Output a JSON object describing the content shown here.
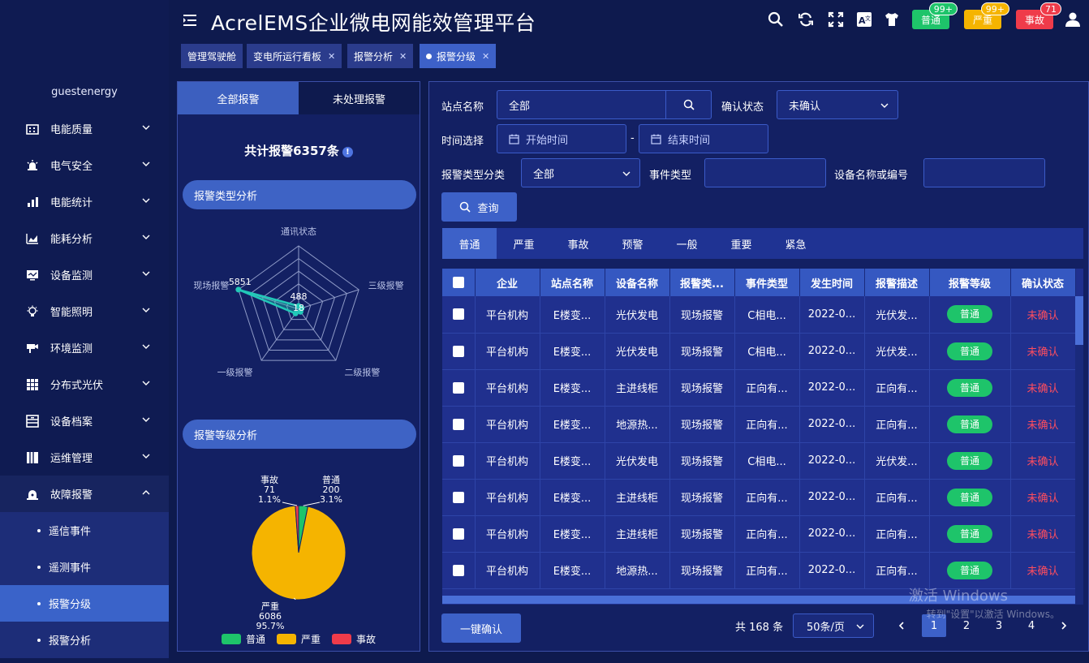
{
  "header": {
    "title": "AcrelEMS企业微电网能效管理平台",
    "badges": [
      {
        "label": "普通",
        "count": "99+",
        "color": "#1ec46a"
      },
      {
        "label": "严重",
        "count": "99+",
        "color": "#f5b400"
      },
      {
        "label": "事故",
        "count": "71",
        "color": "#ef3b4a"
      }
    ]
  },
  "tabs": [
    {
      "label": "管理驾驶舱",
      "closable": false
    },
    {
      "label": "变电所运行看板",
      "closable": true
    },
    {
      "label": "报警分析",
      "closable": true
    },
    {
      "label": "报警分级",
      "closable": true,
      "active": true
    }
  ],
  "sidebar": {
    "user": "guestenergy",
    "items": [
      {
        "label": "电能质量"
      },
      {
        "label": "电气安全"
      },
      {
        "label": "电能统计"
      },
      {
        "label": "能耗分析"
      },
      {
        "label": "设备监测"
      },
      {
        "label": "智能照明"
      },
      {
        "label": "环境监测"
      },
      {
        "label": "分布式光伏"
      },
      {
        "label": "设备档案"
      },
      {
        "label": "运维管理"
      },
      {
        "label": "故障报警"
      }
    ],
    "subitems": [
      {
        "label": "遥信事件"
      },
      {
        "label": "遥测事件"
      },
      {
        "label": "报警分级"
      },
      {
        "label": "报警分析"
      }
    ]
  },
  "left": {
    "tab_all": "全部报警",
    "tab_unhandled": "未处理报警",
    "total_label": "共计报警6357条",
    "section_type": "报警类型分析",
    "section_level": "报警等级分析",
    "legend": [
      {
        "label": "普通",
        "color": "#1ec46a"
      },
      {
        "label": "严重",
        "color": "#f5b400"
      },
      {
        "label": "事故",
        "color": "#ef3b4a"
      }
    ]
  },
  "filters": {
    "site_label": "站点名称",
    "site_value": "全部",
    "confirm_label": "确认状态",
    "confirm_value": "未确认",
    "time_label": "时间选择",
    "start_placeholder": "开始时间",
    "end_placeholder": "结束时间",
    "dash": "-",
    "type_label": "报警类型分类",
    "type_value": "全部",
    "event_label": "事件类型",
    "device_label": "设备名称或编号",
    "query_button": "查询"
  },
  "level_tabs": [
    "普通",
    "严重",
    "事故",
    "预警",
    "一般",
    "重要",
    "紧急"
  ],
  "table": {
    "headers": [
      "企业",
      "站点名称",
      "设备名称",
      "报警类...",
      "事件类型",
      "发生时间",
      "报警描述",
      "报警等级",
      "确认状态"
    ],
    "rows": [
      [
        "平台机构",
        "E楼变...",
        "光伏发电",
        "现场报警",
        "C相电...",
        "2022-0...",
        "光伏发...",
        "普通",
        "未确认"
      ],
      [
        "平台机构",
        "E楼变...",
        "光伏发电",
        "现场报警",
        "C相电...",
        "2022-0...",
        "光伏发...",
        "普通",
        "未确认"
      ],
      [
        "平台机构",
        "E楼变...",
        "主进线柜",
        "现场报警",
        "正向有...",
        "2022-0...",
        "正向有...",
        "普通",
        "未确认"
      ],
      [
        "平台机构",
        "E楼变...",
        "地源热...",
        "现场报警",
        "正向有...",
        "2022-0...",
        "正向有...",
        "普通",
        "未确认"
      ],
      [
        "平台机构",
        "E楼变...",
        "光伏发电",
        "现场报警",
        "C相电...",
        "2022-0...",
        "光伏发...",
        "普通",
        "未确认"
      ],
      [
        "平台机构",
        "E楼变...",
        "主进线柜",
        "现场报警",
        "正向有...",
        "2022-0...",
        "正向有...",
        "普通",
        "未确认"
      ],
      [
        "平台机构",
        "E楼变...",
        "主进线柜",
        "现场报警",
        "正向有...",
        "2022-0...",
        "正向有...",
        "普通",
        "未确认"
      ],
      [
        "平台机构",
        "E楼变...",
        "地源热...",
        "现场报警",
        "正向有...",
        "2022-0...",
        "正向有...",
        "普通",
        "未确认"
      ]
    ]
  },
  "footer": {
    "confirm_all": "一键确认",
    "total": "共 168 条",
    "page_size": "50条/页",
    "pages": [
      "1",
      "2",
      "3",
      "4"
    ],
    "current_page": "1"
  },
  "watermark": {
    "line1": "激活 Windows",
    "line2": "转到\"设置\"以激活 Windows。"
  },
  "chart_data": [
    {
      "type": "radar",
      "indicators": [
        "通讯状态",
        "三级报警",
        "二级报警",
        "一级报警",
        "现场报警"
      ],
      "values": [
        18,
        0,
        0,
        488,
        5851
      ],
      "labels_shown": [
        "488",
        "18",
        "5851"
      ]
    },
    {
      "type": "pie",
      "categories": [
        "普通",
        "严重",
        "事故"
      ],
      "values": [
        200,
        6086,
        71
      ],
      "percents": [
        "3.1%",
        "95.7%",
        "1.1%"
      ],
      "colors": [
        "#1ec46a",
        "#f5b400",
        "#ef3b4a"
      ]
    }
  ]
}
